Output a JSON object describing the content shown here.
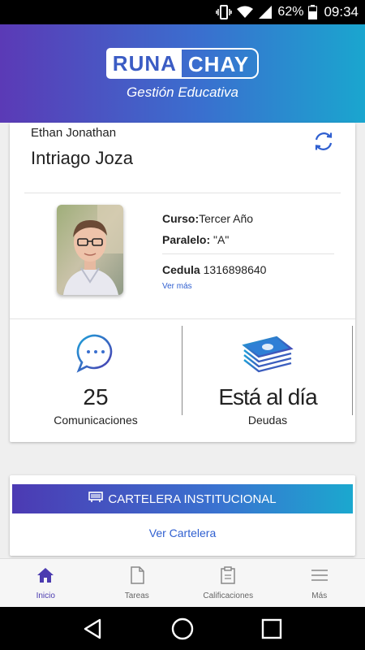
{
  "status_bar": {
    "battery_percent": "62%",
    "time": "09:34"
  },
  "header": {
    "logo_part1": "RUNA",
    "logo_part2": "CHAY",
    "subtitle": "Gestión Educativa"
  },
  "profile": {
    "first_name": "Ethan Jonathan",
    "last_name": "Intriago Joza",
    "curso_label": "Curso:",
    "curso_value": "Tercer Año",
    "paralelo_label": "Paralelo:",
    "paralelo_value": " \"A\"",
    "cedula_label": "Cedula",
    "cedula_value": " 1316898640",
    "ver_mas": "Ver más"
  },
  "stats": {
    "comunicaciones_value": "25",
    "comunicaciones_label": "Comunicaciones",
    "deudas_value": "Está al día",
    "deudas_label": "Deudas"
  },
  "cartelera": {
    "banner_label": "CARTELERA INSTITUCIONAL",
    "link_label": "Ver Cartelera"
  },
  "bottom_nav": [
    {
      "label": "Inicio",
      "icon": "home-icon",
      "active": true
    },
    {
      "label": "Tareas",
      "icon": "document-icon",
      "active": false
    },
    {
      "label": "Calificaciones",
      "icon": "clipboard-icon",
      "active": false
    },
    {
      "label": "Más",
      "icon": "menu-icon",
      "active": false
    }
  ],
  "colors": {
    "accent": "#4b3bb0",
    "gradient_start": "#5b3ab6",
    "gradient_end": "#1aa6cf",
    "link": "#2f5fd0"
  }
}
